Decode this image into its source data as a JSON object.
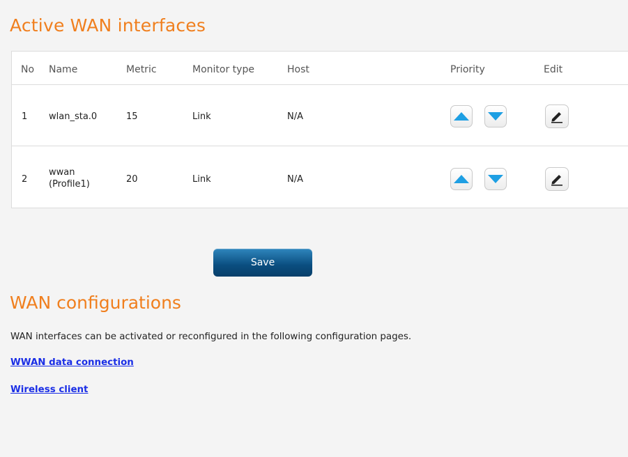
{
  "active_wan": {
    "title": "Active WAN interfaces",
    "columns": {
      "no": "No",
      "name": "Name",
      "metric": "Metric",
      "monitor_type": "Monitor type",
      "host": "Host",
      "priority": "Priority",
      "edit": "Edit"
    },
    "rows": [
      {
        "no": "1",
        "name_line1": "wlan_sta.0",
        "name_line2": "",
        "metric": "15",
        "monitor_type": "Link",
        "host": "N/A"
      },
      {
        "no": "2",
        "name_line1": "wwan",
        "name_line2": "(Profile1)",
        "metric": "20",
        "monitor_type": "Link",
        "host": "N/A"
      }
    ],
    "icons": {
      "up": "arrow-up-icon",
      "down": "arrow-down-icon",
      "edit": "pencil-icon"
    },
    "colors": {
      "arrow": "#1e9fe3",
      "heading": "#f07f1e",
      "link": "#1a2ee6",
      "save_button": "#0a4d7f"
    }
  },
  "save_label": "Save",
  "wan_config": {
    "title": "WAN configurations",
    "description": "WAN interfaces can be activated or reconfigured in the following configuration pages.",
    "links": [
      "WWAN data connection",
      "Wireless client"
    ]
  }
}
